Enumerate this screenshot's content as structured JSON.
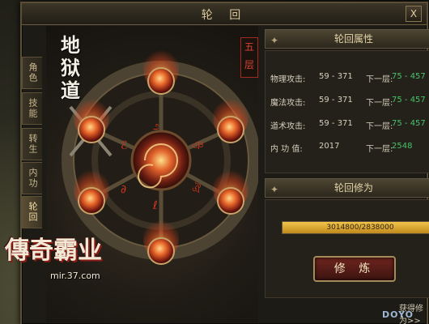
{
  "window": {
    "title": "轮 回",
    "close_label": "X"
  },
  "tabs": [
    {
      "label": "角色",
      "active": false
    },
    {
      "label": "技能",
      "active": false
    },
    {
      "label": "转生",
      "active": false
    },
    {
      "label": "内功",
      "active": false
    },
    {
      "label": "轮回",
      "active": true
    }
  ],
  "realm": {
    "name": "地狱道",
    "level_label": "五层"
  },
  "attributes": {
    "header": "轮回属性",
    "next_label": "下一层:",
    "rows": [
      {
        "label": "物理攻击:",
        "value": "59 - 371",
        "next": "75 - 457"
      },
      {
        "label": "魔法攻击:",
        "value": "59 - 371",
        "next": "75 - 457"
      },
      {
        "label": "道术攻击:",
        "value": "59 - 371",
        "next": "75 - 457"
      },
      {
        "label": "内 功 值:",
        "value": "2017",
        "next": "2548"
      }
    ]
  },
  "cultivate": {
    "header": "轮回修为",
    "progress_text": "3014800/2838000",
    "progress_fraction": 1.0,
    "button_label": "修 炼",
    "more_link": "获得修为>>"
  },
  "logo": {
    "text": "傳奇霸业",
    "url": "mir.37.com"
  },
  "watermark": "DOYO",
  "colors": {
    "accent_green": "#47c26a",
    "progress_gold": "#e3b53c",
    "title_gold": "#d9c79a",
    "button_red": "#6e241e"
  }
}
